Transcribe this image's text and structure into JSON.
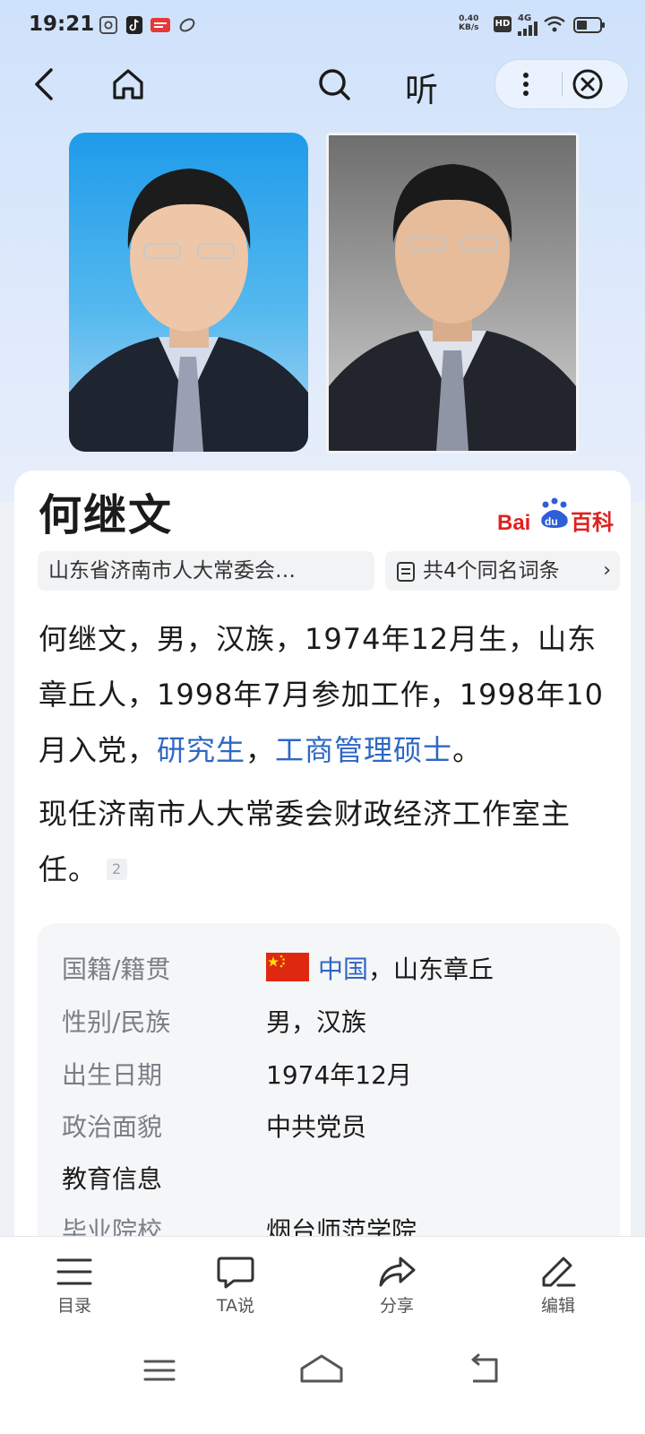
{
  "status_bar": {
    "time": "19:21",
    "net_speed_value": "0.40",
    "net_speed_unit": "KB/s",
    "hd_badge": "HD",
    "network": "4G"
  },
  "nav": {
    "listen_label": "听"
  },
  "entry": {
    "title": "何继文",
    "source_logo_text": "Bai du 百科",
    "subtitle_chip": "山东省济南市人大常委会…",
    "same_name_chip": "共4个同名词条",
    "summary": {
      "part1": "何继文，男，汉族，1974年12月生，山东章丘人，1998年7月参加工作，1998年10月入党，",
      "link1": "研究生",
      "sep": "，",
      "link2": "工商管理硕士",
      "end": "。"
    },
    "position": {
      "text": "现任济南市人大常委会财政经济工作室主任。",
      "ref": "2"
    }
  },
  "info_table": {
    "rows": [
      {
        "key": "国籍/籍贯",
        "value_link": "中国",
        "value_rest": "，山东章丘"
      },
      {
        "key": "性别/民族",
        "value": "男，汉族"
      },
      {
        "key": "出生日期",
        "value": "1974年12月"
      },
      {
        "key": "政治面貌",
        "value": "中共党员"
      },
      {
        "key": "教育信息"
      },
      {
        "key": "毕业院校",
        "value_link": "烟台师范学院"
      }
    ]
  },
  "toolbar": {
    "items": [
      {
        "label": "目录",
        "icon": "menu-icon"
      },
      {
        "label": "TA说",
        "icon": "chat-icon"
      },
      {
        "label": "分享",
        "icon": "share-icon"
      },
      {
        "label": "编辑",
        "icon": "edit-icon"
      }
    ]
  },
  "colors": {
    "link": "#2e67c4",
    "baike_red": "#e02020",
    "baike_blue": "#2e5fd8"
  }
}
